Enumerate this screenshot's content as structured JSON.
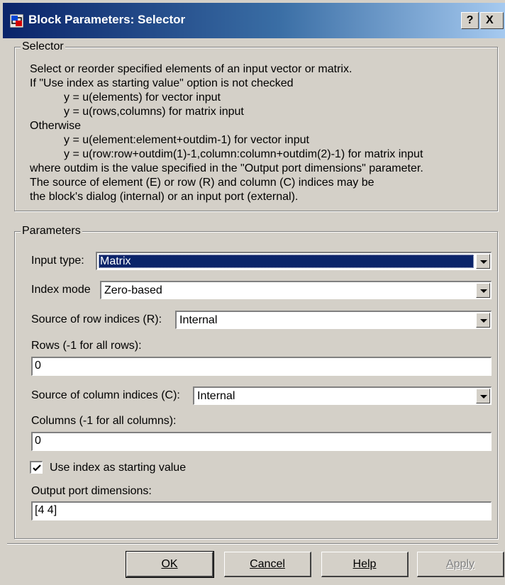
{
  "window": {
    "title": "Block Parameters: Selector",
    "help_glyph": "?",
    "close_glyph": "X"
  },
  "selector_group": {
    "label": "Selector",
    "lines": [
      "Select or reorder specified elements of an input vector or matrix.",
      "If \"Use index as starting value\" option is not checked",
      "y = u(elements) for vector input",
      "y = u(rows,columns) for matrix input",
      "Otherwise",
      "y = u(element:element+outdim-1) for vector input",
      "y = u(row:row+outdim(1)-1,column:column+outdim(2)-1) for matrix input",
      "where outdim is the value specified in the \"Output port dimensions\" parameter.",
      "The source of element (E) or row (R) and column (C) indices may be",
      "the block's dialog (internal) or an input port (external)."
    ]
  },
  "parameters_group": {
    "label": "Parameters",
    "input_type": {
      "label": "Input type:",
      "value": "Matrix"
    },
    "index_mode": {
      "label": "Index mode",
      "value": "Zero-based"
    },
    "row_source": {
      "label": "Source of row indices (R):",
      "value": "Internal"
    },
    "rows": {
      "label": "Rows (-1 for all rows):",
      "value": "0"
    },
    "column_source": {
      "label": "Source of column indices (C):",
      "value": "Internal"
    },
    "columns": {
      "label": "Columns (-1 for all columns):",
      "value": "0"
    },
    "use_index_start": {
      "label": "Use index as starting value",
      "checked": true
    },
    "output_dims": {
      "label": "Output port dimensions:",
      "value": "[4 4]"
    }
  },
  "buttons": {
    "ok": "OK",
    "cancel": "Cancel",
    "help": "Help",
    "apply": "Apply"
  },
  "icons": {
    "app": "simulink-block-icon",
    "dropdown": "chevron-down-icon",
    "check": "check-icon"
  },
  "colors": {
    "title_gradient_start": "#0a246a",
    "title_gradient_end": "#a6caf0",
    "selection": "#0a246a",
    "face": "#d4d0c8"
  }
}
